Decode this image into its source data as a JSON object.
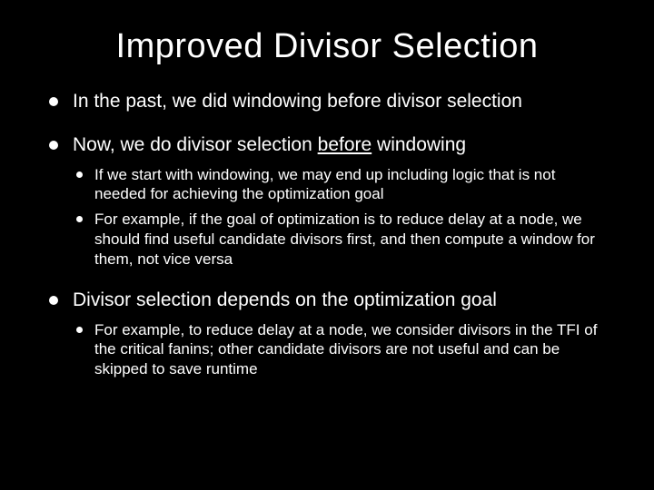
{
  "title": "Improved Divisor Selection",
  "bullets": {
    "b1": "In the past, we did windowing before divisor selection",
    "b2_pre": "Now, we do divisor selection ",
    "b2_underline": "before",
    "b2_post": " windowing",
    "b2_sub1": "If we start with windowing, we may end up including logic that is not needed for achieving the optimization goal",
    "b2_sub2": "For example, if the goal of optimization is to reduce delay at a node, we should find useful candidate divisors first, and then compute a window for them, not vice versa",
    "b3": "Divisor selection depends on the optimization goal",
    "b3_sub1": "For example, to reduce delay at a node, we consider divisors in the TFI of the critical fanins; other candidate divisors are not useful and can be skipped to save runtime"
  }
}
